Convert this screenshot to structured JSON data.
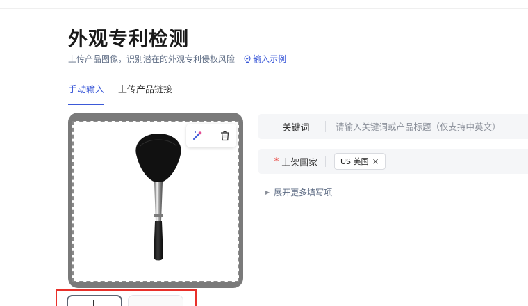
{
  "header": {
    "title": "外观专利检测",
    "subtitle": "上传产品图像，识别潜在的外观专利侵权风险",
    "example_link": "输入示例"
  },
  "tabs": [
    {
      "label": "手动输入",
      "active": true
    },
    {
      "label": "上传产品链接",
      "active": false
    }
  ],
  "image_upload": {
    "tools": {
      "magic_icon": "magic-wand-icon",
      "delete_icon": "trash-icon"
    }
  },
  "form": {
    "keyword": {
      "label": "关键词",
      "placeholder": "请输入关键词或产品标题（仅支持中英文）",
      "value": ""
    },
    "country": {
      "required_mark": "*",
      "label": "上架国家",
      "tags": [
        {
          "label": "US 美国",
          "close": "×"
        }
      ]
    },
    "expand_more": "展开更多填写项"
  },
  "colors": {
    "accent": "#3b59d8",
    "required": "#e8302a",
    "highlight_border": "#e8302a"
  }
}
